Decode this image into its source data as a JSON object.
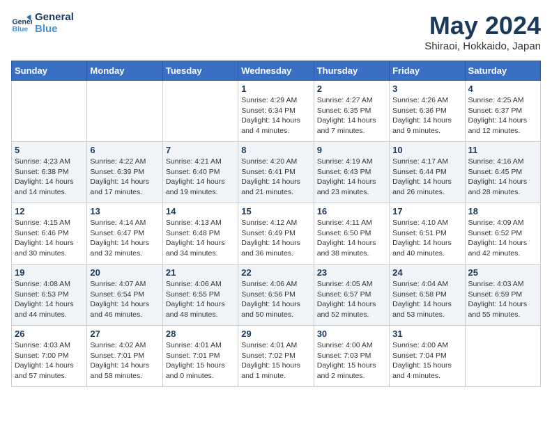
{
  "logo": {
    "line1": "General",
    "line2": "Blue"
  },
  "title": "May 2024",
  "subtitle": "Shiraoi, Hokkaido, Japan",
  "days_header": [
    "Sunday",
    "Monday",
    "Tuesday",
    "Wednesday",
    "Thursday",
    "Friday",
    "Saturday"
  ],
  "weeks": [
    [
      {
        "num": "",
        "info": ""
      },
      {
        "num": "",
        "info": ""
      },
      {
        "num": "",
        "info": ""
      },
      {
        "num": "1",
        "info": "Sunrise: 4:29 AM\nSunset: 6:34 PM\nDaylight: 14 hours\nand 4 minutes."
      },
      {
        "num": "2",
        "info": "Sunrise: 4:27 AM\nSunset: 6:35 PM\nDaylight: 14 hours\nand 7 minutes."
      },
      {
        "num": "3",
        "info": "Sunrise: 4:26 AM\nSunset: 6:36 PM\nDaylight: 14 hours\nand 9 minutes."
      },
      {
        "num": "4",
        "info": "Sunrise: 4:25 AM\nSunset: 6:37 PM\nDaylight: 14 hours\nand 12 minutes."
      }
    ],
    [
      {
        "num": "5",
        "info": "Sunrise: 4:23 AM\nSunset: 6:38 PM\nDaylight: 14 hours\nand 14 minutes."
      },
      {
        "num": "6",
        "info": "Sunrise: 4:22 AM\nSunset: 6:39 PM\nDaylight: 14 hours\nand 17 minutes."
      },
      {
        "num": "7",
        "info": "Sunrise: 4:21 AM\nSunset: 6:40 PM\nDaylight: 14 hours\nand 19 minutes."
      },
      {
        "num": "8",
        "info": "Sunrise: 4:20 AM\nSunset: 6:41 PM\nDaylight: 14 hours\nand 21 minutes."
      },
      {
        "num": "9",
        "info": "Sunrise: 4:19 AM\nSunset: 6:43 PM\nDaylight: 14 hours\nand 23 minutes."
      },
      {
        "num": "10",
        "info": "Sunrise: 4:17 AM\nSunset: 6:44 PM\nDaylight: 14 hours\nand 26 minutes."
      },
      {
        "num": "11",
        "info": "Sunrise: 4:16 AM\nSunset: 6:45 PM\nDaylight: 14 hours\nand 28 minutes."
      }
    ],
    [
      {
        "num": "12",
        "info": "Sunrise: 4:15 AM\nSunset: 6:46 PM\nDaylight: 14 hours\nand 30 minutes."
      },
      {
        "num": "13",
        "info": "Sunrise: 4:14 AM\nSunset: 6:47 PM\nDaylight: 14 hours\nand 32 minutes."
      },
      {
        "num": "14",
        "info": "Sunrise: 4:13 AM\nSunset: 6:48 PM\nDaylight: 14 hours\nand 34 minutes."
      },
      {
        "num": "15",
        "info": "Sunrise: 4:12 AM\nSunset: 6:49 PM\nDaylight: 14 hours\nand 36 minutes."
      },
      {
        "num": "16",
        "info": "Sunrise: 4:11 AM\nSunset: 6:50 PM\nDaylight: 14 hours\nand 38 minutes."
      },
      {
        "num": "17",
        "info": "Sunrise: 4:10 AM\nSunset: 6:51 PM\nDaylight: 14 hours\nand 40 minutes."
      },
      {
        "num": "18",
        "info": "Sunrise: 4:09 AM\nSunset: 6:52 PM\nDaylight: 14 hours\nand 42 minutes."
      }
    ],
    [
      {
        "num": "19",
        "info": "Sunrise: 4:08 AM\nSunset: 6:53 PM\nDaylight: 14 hours\nand 44 minutes."
      },
      {
        "num": "20",
        "info": "Sunrise: 4:07 AM\nSunset: 6:54 PM\nDaylight: 14 hours\nand 46 minutes."
      },
      {
        "num": "21",
        "info": "Sunrise: 4:06 AM\nSunset: 6:55 PM\nDaylight: 14 hours\nand 48 minutes."
      },
      {
        "num": "22",
        "info": "Sunrise: 4:06 AM\nSunset: 6:56 PM\nDaylight: 14 hours\nand 50 minutes."
      },
      {
        "num": "23",
        "info": "Sunrise: 4:05 AM\nSunset: 6:57 PM\nDaylight: 14 hours\nand 52 minutes."
      },
      {
        "num": "24",
        "info": "Sunrise: 4:04 AM\nSunset: 6:58 PM\nDaylight: 14 hours\nand 53 minutes."
      },
      {
        "num": "25",
        "info": "Sunrise: 4:03 AM\nSunset: 6:59 PM\nDaylight: 14 hours\nand 55 minutes."
      }
    ],
    [
      {
        "num": "26",
        "info": "Sunrise: 4:03 AM\nSunset: 7:00 PM\nDaylight: 14 hours\nand 57 minutes."
      },
      {
        "num": "27",
        "info": "Sunrise: 4:02 AM\nSunset: 7:01 PM\nDaylight: 14 hours\nand 58 minutes."
      },
      {
        "num": "28",
        "info": "Sunrise: 4:01 AM\nSunset: 7:01 PM\nDaylight: 15 hours\nand 0 minutes."
      },
      {
        "num": "29",
        "info": "Sunrise: 4:01 AM\nSunset: 7:02 PM\nDaylight: 15 hours\nand 1 minute."
      },
      {
        "num": "30",
        "info": "Sunrise: 4:00 AM\nSunset: 7:03 PM\nDaylight: 15 hours\nand 2 minutes."
      },
      {
        "num": "31",
        "info": "Sunrise: 4:00 AM\nSunset: 7:04 PM\nDaylight: 15 hours\nand 4 minutes."
      },
      {
        "num": "",
        "info": ""
      }
    ]
  ]
}
